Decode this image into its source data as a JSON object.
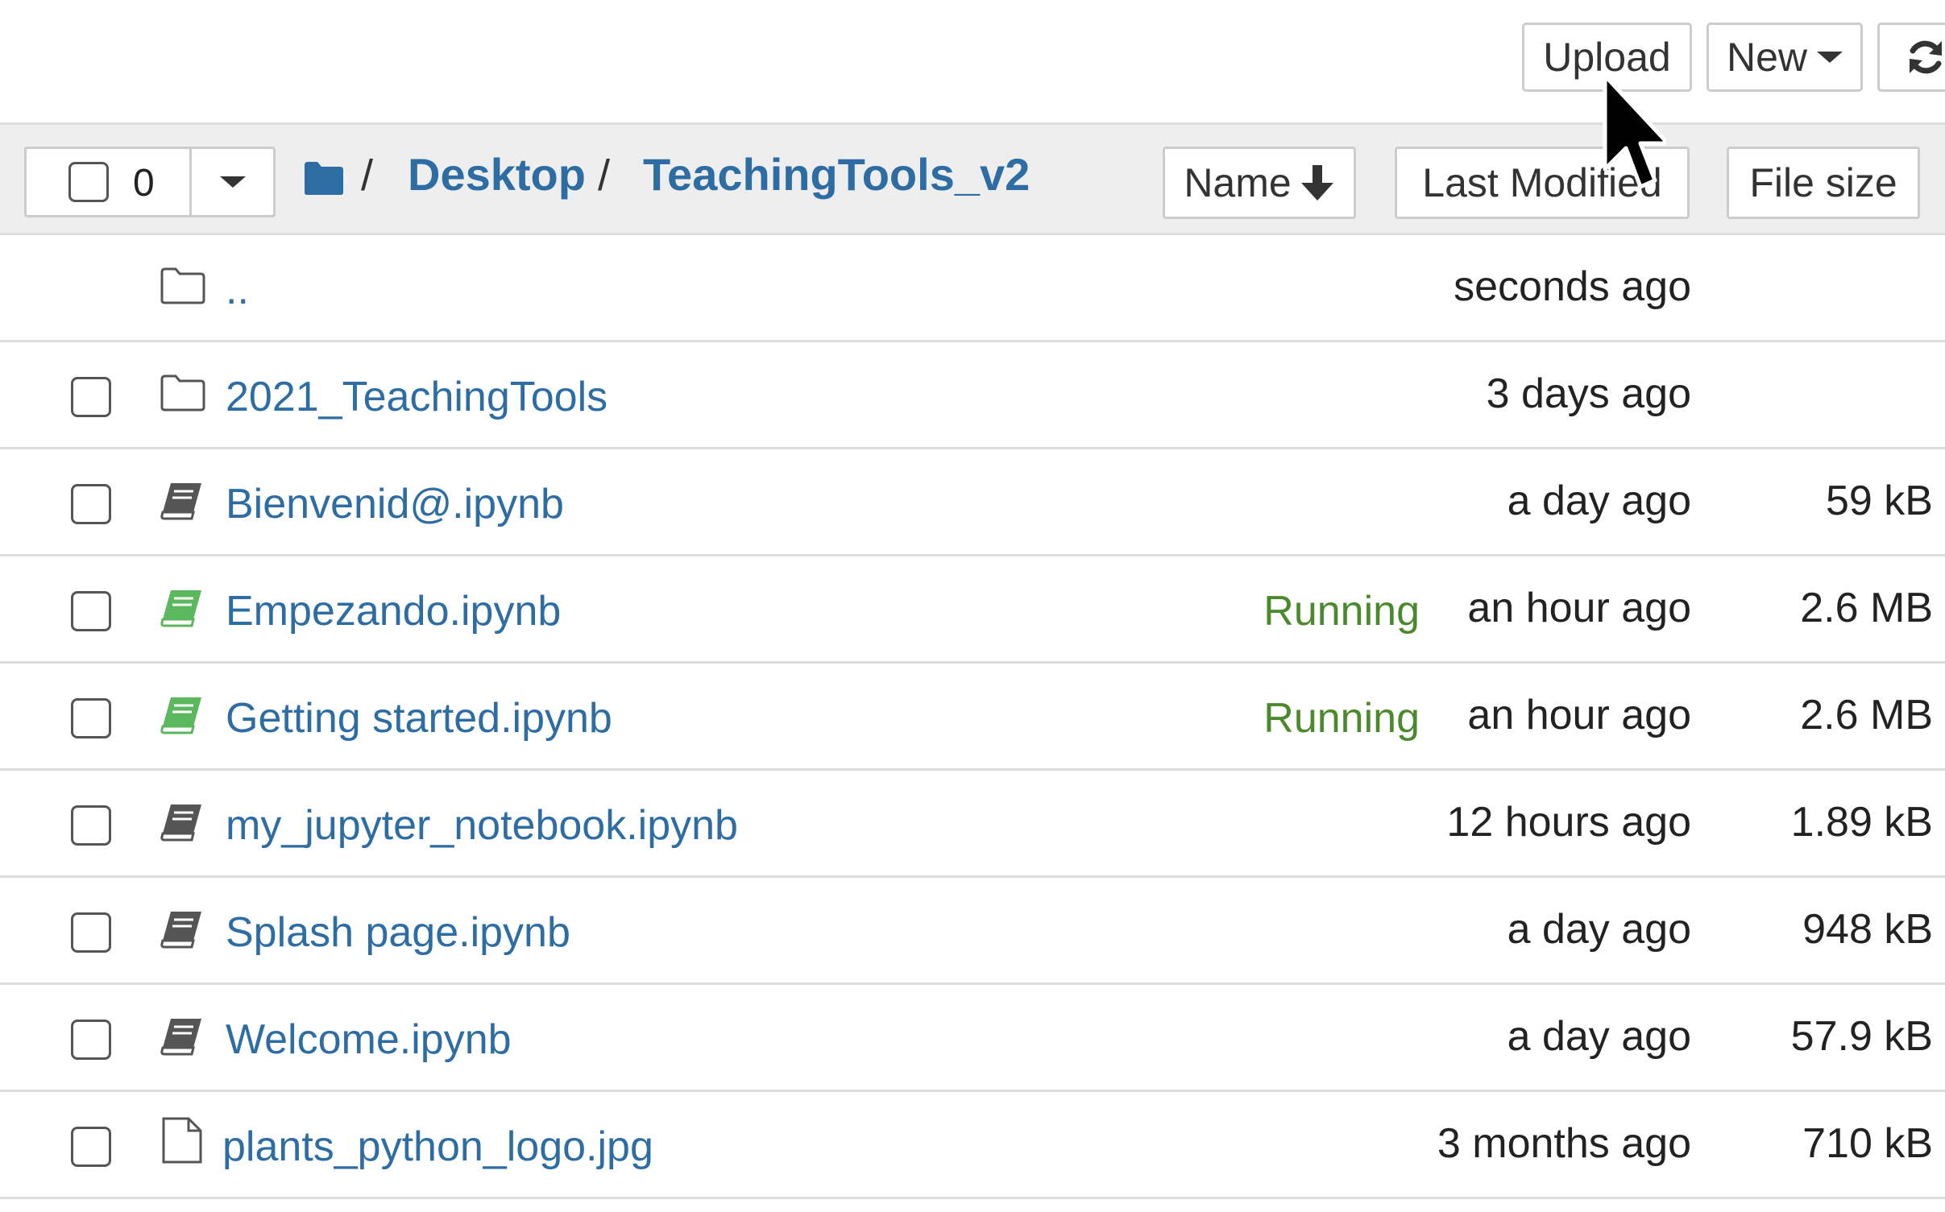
{
  "toolbar": {
    "upload_label": "Upload",
    "new_label": "New",
    "refresh_icon": "refresh-icon"
  },
  "list_header": {
    "selected_count": "0",
    "breadcrumb": {
      "root_icon": "folder-icon",
      "separator": "/",
      "items": [
        "Desktop",
        "TeachingTools_v2"
      ]
    },
    "sort_buttons": {
      "name": "Name",
      "name_icon": "arrow-down-icon",
      "last_modified": "Last Modified",
      "file_size": "File size"
    }
  },
  "files": [
    {
      "type": "parent",
      "icon": "folder-outline-icon",
      "name": "..",
      "status": "",
      "modified": "seconds ago",
      "size": ""
    },
    {
      "type": "folder",
      "icon": "folder-outline-icon",
      "name": "2021_TeachingTools",
      "status": "",
      "modified": "3 days ago",
      "size": ""
    },
    {
      "type": "notebook",
      "icon": "notebook-icon",
      "name": "Bienvenid@.ipynb",
      "status": "",
      "modified": "a day ago",
      "size": "59 kB"
    },
    {
      "type": "notebook-running",
      "icon": "notebook-running-icon",
      "name": "Empezando.ipynb",
      "status": "Running",
      "modified": "an hour ago",
      "size": "2.6 MB"
    },
    {
      "type": "notebook-running",
      "icon": "notebook-running-icon",
      "name": "Getting started.ipynb",
      "status": "Running",
      "modified": "an hour ago",
      "size": "2.6 MB"
    },
    {
      "type": "notebook",
      "icon": "notebook-icon",
      "name": "my_jupyter_notebook.ipynb",
      "status": "",
      "modified": "12 hours ago",
      "size": "1.89 kB"
    },
    {
      "type": "notebook",
      "icon": "notebook-icon",
      "name": "Splash page.ipynb",
      "status": "",
      "modified": "a day ago",
      "size": "948 kB"
    },
    {
      "type": "notebook",
      "icon": "notebook-icon",
      "name": "Welcome.ipynb",
      "status": "",
      "modified": "a day ago",
      "size": "57.9 kB"
    },
    {
      "type": "file",
      "icon": "file-icon",
      "name": "plants_python_logo.jpg",
      "status": "",
      "modified": "3 months ago",
      "size": "710 kB"
    }
  ],
  "colors": {
    "link": "#2e6da4",
    "running": "#4a8a2c",
    "header_bg": "#eeeeee",
    "border": "#cccccc"
  }
}
